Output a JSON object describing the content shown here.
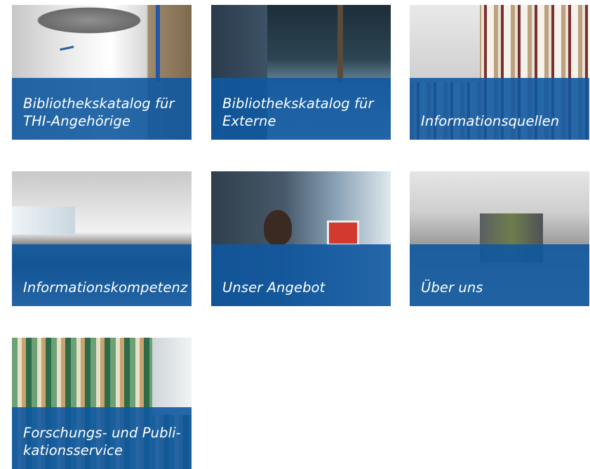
{
  "tiles": [
    {
      "id": "tile-thi-catalog",
      "label": "Bibliothekskatalog für\nTHI-Angehörige",
      "photo": "hochschule-tin"
    },
    {
      "id": "tile-external-catalog",
      "label": "Bibliothekskatalog für\nExterne",
      "photo": "library-window"
    },
    {
      "id": "tile-information-sources",
      "label": "Informationsquellen",
      "photo": "bookshelves"
    },
    {
      "id": "tile-information-competence",
      "label": "Informationskompetenz",
      "photo": "computer-room"
    },
    {
      "id": "tile-our-offer",
      "label": "Unser Angebot",
      "photo": "people-at-desk"
    },
    {
      "id": "tile-about-us",
      "label": "Über uns",
      "photo": "students-library"
    },
    {
      "id": "tile-research-publication",
      "label": "Forschungs- und Publi-\nkationsservice",
      "photo": "bookshelf-closeup"
    }
  ],
  "colors": {
    "overlay": "#1058a0",
    "label_text": "#ffffff",
    "background": "#ffffff"
  }
}
